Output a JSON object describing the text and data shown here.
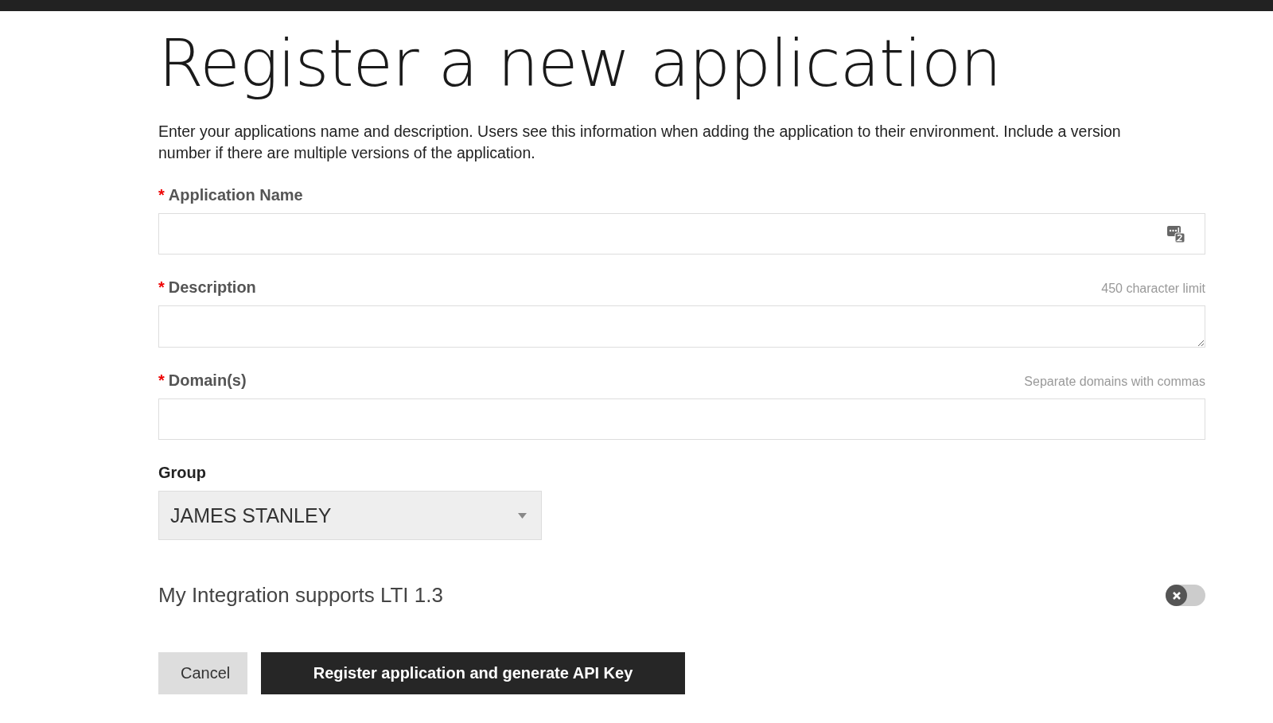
{
  "title": "Register a new application",
  "intro": "Enter your applications name and description. Users see this information when adding the application to their environment. Include a version number if there are multiple versions of the application.",
  "fields": [
    {
      "kind": "input",
      "label": "Application Name",
      "required_mark": "*",
      "has_icon": true
    },
    {
      "kind": "textarea",
      "label": "Description",
      "required_mark": "*",
      "hint": "450 character limit"
    },
    {
      "kind": "input",
      "label": "Domain(s)",
      "required_mark": "*",
      "hint": "Separate domains with commas"
    },
    {
      "kind": "select",
      "label": "Group",
      "value": "JAMES STANLEY"
    }
  ],
  "lti_toggle": {
    "label": "My Integration supports LTI 1.3",
    "on": false
  },
  "buttons": [
    {
      "kind": "secondary",
      "label": "Cancel"
    },
    {
      "kind": "primary",
      "label": "Register application and generate API Key"
    }
  ]
}
